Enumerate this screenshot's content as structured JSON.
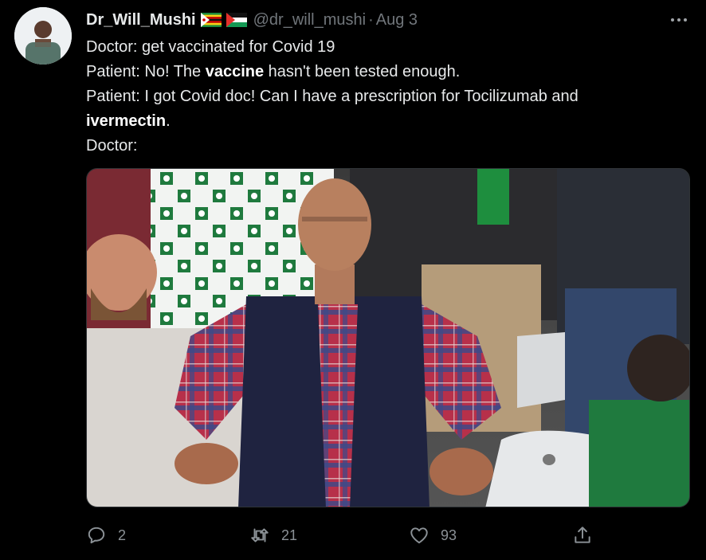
{
  "tweet": {
    "display_name": "Dr_Will_Mushi",
    "handle": "@dr_will_mushi",
    "separator": "·",
    "date": "Aug 3",
    "flags": [
      "zimbabwe-flag",
      "palestine-flag"
    ],
    "lines": [
      {
        "pre": "Doctor: get vaccinated for Covid 19",
        "bold": "",
        "post": ""
      },
      {
        "pre": "Patient: No! The ",
        "bold": "vaccine",
        "post": " hasn't been tested enough."
      },
      {
        "pre": "Patient: I got Covid doc! Can I have a prescription for Tocilizumab and",
        "bold": "",
        "post": ""
      },
      {
        "pre": "",
        "bold": "ivermectin",
        "post": "."
      },
      {
        "pre": "Doctor:",
        "bold": "",
        "post": ""
      }
    ]
  },
  "actions": {
    "reply": {
      "icon": "reply-icon",
      "count": "2"
    },
    "retweet": {
      "icon": "retweet-icon",
      "count": "21"
    },
    "like": {
      "icon": "heart-icon",
      "count": "93"
    },
    "share": {
      "icon": "share-icon"
    }
  },
  "colors": {
    "background": "#000000",
    "text": "#e7e9ea",
    "muted": "#71767b"
  }
}
